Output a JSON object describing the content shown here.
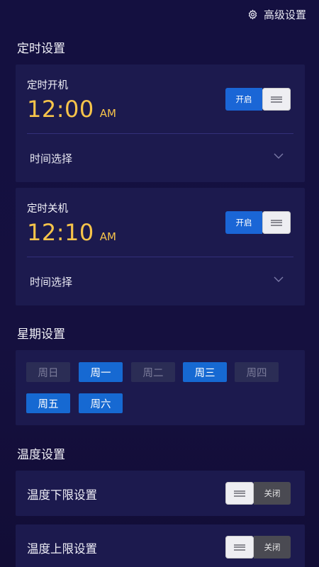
{
  "header": {
    "advanced_settings": "高级设置"
  },
  "sections": {
    "timer": "定时设置",
    "week": "星期设置",
    "temperature": "温度设置"
  },
  "power_on": {
    "label": "定时开机",
    "time": "12:00",
    "ampm": "AM",
    "toggle_label": "开启",
    "time_select": "时间选择"
  },
  "power_off": {
    "label": "定时关机",
    "time": "12:10",
    "ampm": "AM",
    "toggle_label": "开启",
    "time_select": "时间选择"
  },
  "week": {
    "days": [
      {
        "label": "周日",
        "active": false
      },
      {
        "label": "周一",
        "active": true
      },
      {
        "label": "周二",
        "active": false
      },
      {
        "label": "周三",
        "active": true
      },
      {
        "label": "周四",
        "active": false
      },
      {
        "label": "周五",
        "active": true
      },
      {
        "label": "周六",
        "active": true
      }
    ]
  },
  "temperature": {
    "lower": {
      "label": "温度下限设置",
      "toggle_label": "关闭"
    },
    "upper": {
      "label": "温度上限设置",
      "toggle_label": "关闭"
    }
  },
  "colors": {
    "accent": "#1a66d6",
    "time": "#f7c44a",
    "card": "#1c1a4e",
    "background": "#141040"
  },
  "icons": {
    "advanced": "gear-icon",
    "expand": "chevron-down-icon",
    "toggle_knob": "menu-lines-icon"
  }
}
